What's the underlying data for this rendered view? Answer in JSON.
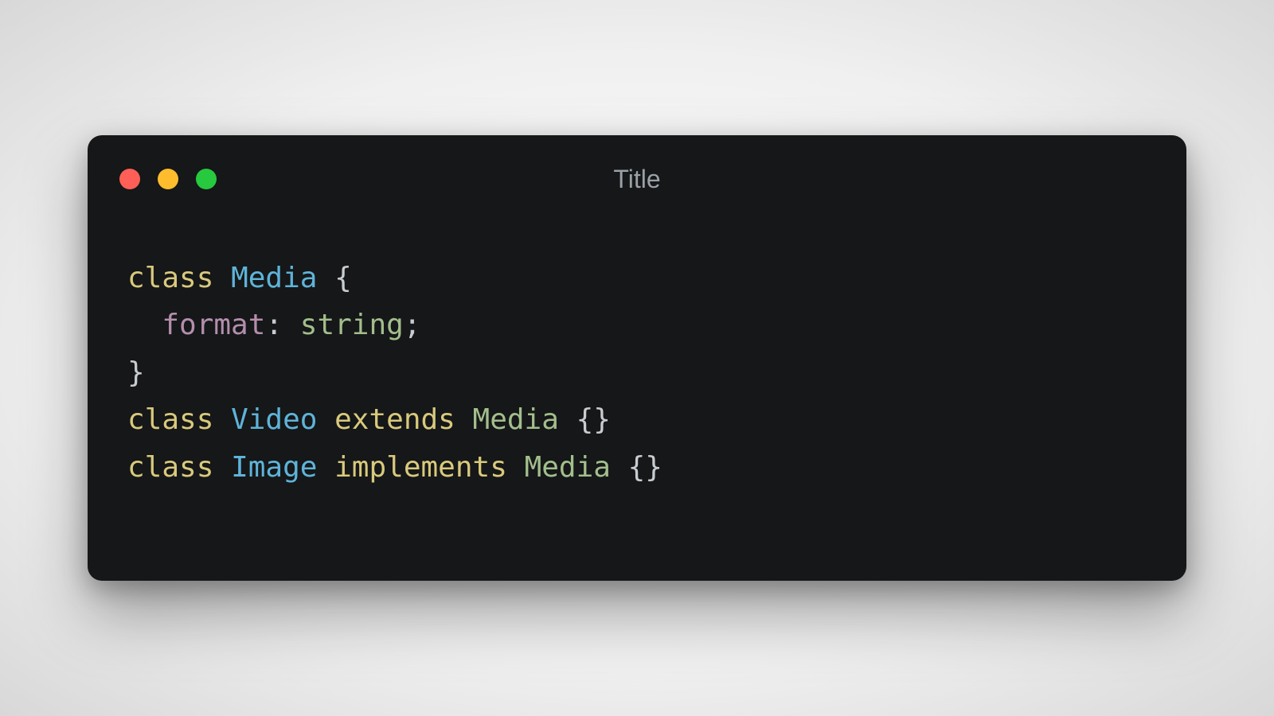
{
  "window": {
    "title": "Title",
    "traffic_lights": {
      "close": "close",
      "minimize": "minimize",
      "maximize": "maximize"
    }
  },
  "code": {
    "lines": [
      {
        "tokens": [
          {
            "kind": "keyword",
            "text": "class"
          },
          {
            "kind": "space",
            "text": " "
          },
          {
            "kind": "type",
            "text": "Media"
          },
          {
            "kind": "space",
            "text": " "
          },
          {
            "kind": "punct",
            "text": "{"
          }
        ]
      },
      {
        "tokens": [
          {
            "kind": "space",
            "text": "  "
          },
          {
            "kind": "prop",
            "text": "format"
          },
          {
            "kind": "punct",
            "text": ":"
          },
          {
            "kind": "space",
            "text": " "
          },
          {
            "kind": "typename",
            "text": "string"
          },
          {
            "kind": "punct",
            "text": ";"
          }
        ]
      },
      {
        "tokens": [
          {
            "kind": "punct",
            "text": "}"
          }
        ]
      },
      {
        "tokens": [
          {
            "kind": "keyword",
            "text": "class"
          },
          {
            "kind": "space",
            "text": " "
          },
          {
            "kind": "type",
            "text": "Video"
          },
          {
            "kind": "space",
            "text": " "
          },
          {
            "kind": "keyword",
            "text": "extends"
          },
          {
            "kind": "space",
            "text": " "
          },
          {
            "kind": "typename",
            "text": "Media"
          },
          {
            "kind": "space",
            "text": " "
          },
          {
            "kind": "punct",
            "text": "{}"
          }
        ]
      },
      {
        "tokens": [
          {
            "kind": "keyword",
            "text": "class"
          },
          {
            "kind": "space",
            "text": " "
          },
          {
            "kind": "type",
            "text": "Image"
          },
          {
            "kind": "space",
            "text": " "
          },
          {
            "kind": "keyword",
            "text": "implements"
          },
          {
            "kind": "space",
            "text": " "
          },
          {
            "kind": "typename",
            "text": "Media"
          },
          {
            "kind": "space",
            "text": " "
          },
          {
            "kind": "punct",
            "text": "{}"
          }
        ]
      }
    ]
  },
  "token_classes": {
    "keyword": "tok-keyword",
    "type": "tok-type",
    "prop": "tok-prop",
    "typename": "tok-typename",
    "punct": "tok-punct",
    "space": ""
  }
}
